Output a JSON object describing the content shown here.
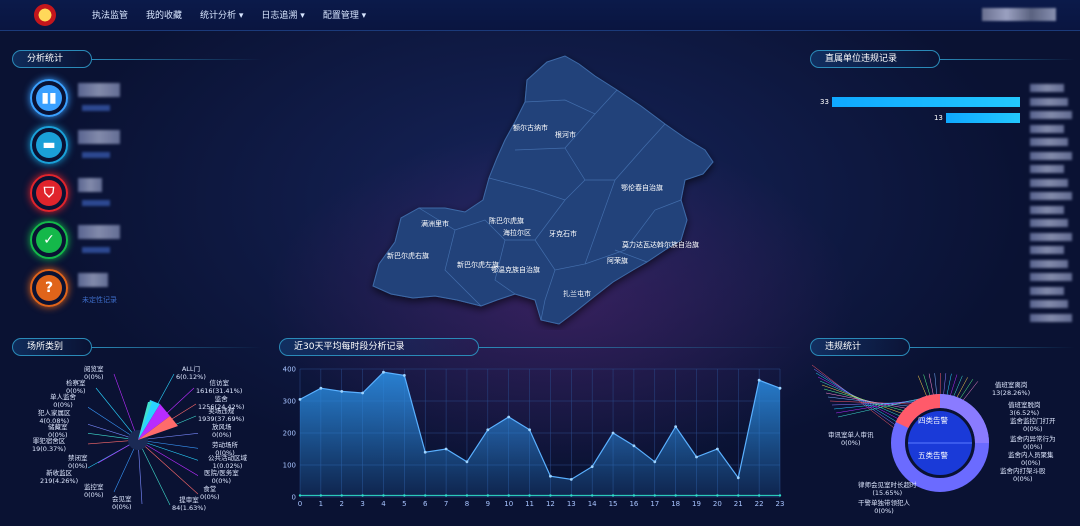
{
  "nav": {
    "items": [
      {
        "label": "执法监管"
      },
      {
        "label": "我的收藏"
      },
      {
        "label": "统计分析 ▾"
      },
      {
        "label": "日志追溯 ▾"
      },
      {
        "label": "配置管理 ▾"
      }
    ]
  },
  "analysis": {
    "title": "分析统计",
    "items": [
      {
        "icon": "bar-chart-icon",
        "color": "#3aa0ff",
        "label": ""
      },
      {
        "icon": "document-icon",
        "color": "#1aa0d8",
        "label": ""
      },
      {
        "icon": "shield-alert-icon",
        "color": "#e0242c",
        "label": ""
      },
      {
        "icon": "check-icon",
        "color": "#14b84a",
        "label": ""
      },
      {
        "icon": "question-icon",
        "color": "#e0641a",
        "label": "未定性记录"
      }
    ]
  },
  "map": {
    "regions": [
      {
        "name": "额尔古纳市"
      },
      {
        "name": "根河市"
      },
      {
        "name": "鄂伦春自治旗"
      },
      {
        "name": "满洲里市"
      },
      {
        "name": "陈巴尔虎旗"
      },
      {
        "name": "海拉尔区"
      },
      {
        "name": "牙克石市"
      },
      {
        "name": "莫力达瓦达斡尔族自治旗"
      },
      {
        "name": "新巴尔虎右旗"
      },
      {
        "name": "新巴尔虎左旗"
      },
      {
        "name": "鄂温克族自治旗"
      },
      {
        "name": "阿荣旗"
      },
      {
        "name": "扎兰屯市"
      }
    ]
  },
  "violations_by_unit": {
    "title": "直属单位违规记录",
    "bars": [
      33,
      13
    ]
  },
  "venue": {
    "title": "场所类别",
    "labels": [
      {
        "name": "ALL门",
        "value": "6(0.12%)"
      },
      {
        "name": "信访室",
        "value": "1616(31.41%)"
      },
      {
        "name": "监舍",
        "value": "1256(24.42%)"
      },
      {
        "name": "卖场违规",
        "value": "1939(37.69%)"
      },
      {
        "name": "放风场",
        "value": "0(0%)"
      },
      {
        "name": "劳动场所",
        "value": "0(0%)"
      },
      {
        "name": "公共活动区域",
        "value": "1(0.02%)"
      },
      {
        "name": "医院/医务室",
        "value": "0(0%)"
      },
      {
        "name": "食堂",
        "value": "0(0%)"
      },
      {
        "name": "提审室",
        "value": "84(1.63%)"
      },
      {
        "name": "会见室",
        "value": "0(0%)"
      },
      {
        "name": "监控室",
        "value": "0(0%)"
      },
      {
        "name": "新收监区",
        "value": "219(4.26%)"
      },
      {
        "name": "禁闭室",
        "value": "0(0%)"
      },
      {
        "name": "罪犯宿舍区",
        "value": "19(0.37%)"
      },
      {
        "name": "储藏室",
        "value": "0(0%)"
      },
      {
        "name": "犯人家属区",
        "value": "4(0.08%)"
      },
      {
        "name": "单人监舍",
        "value": "0(0%)"
      },
      {
        "name": "检察室",
        "value": "0(0%)"
      },
      {
        "name": "阅览室",
        "value": "0(0%)"
      }
    ]
  },
  "hourly": {
    "title": "近30天平均每时段分析记录"
  },
  "chart_data": {
    "type": "area",
    "x": [
      0,
      1,
      2,
      3,
      4,
      5,
      6,
      7,
      8,
      9,
      10,
      11,
      12,
      13,
      14,
      15,
      16,
      17,
      18,
      19,
      20,
      21,
      22,
      23
    ],
    "series": [
      {
        "values": [
          305,
          340,
          330,
          325,
          390,
          380,
          140,
          150,
          110,
          210,
          250,
          210,
          65,
          55,
          95,
          200,
          160,
          110,
          220,
          125,
          150,
          60,
          365,
          340
        ]
      },
      {
        "values": [
          5,
          5,
          5,
          5,
          5,
          5,
          5,
          5,
          5,
          5,
          5,
          5,
          5,
          5,
          5,
          5,
          5,
          5,
          5,
          5,
          5,
          5,
          5,
          5
        ]
      }
    ],
    "ylim": [
      0,
      400
    ],
    "yticks": [
      0,
      100,
      200,
      300,
      400
    ],
    "grid": true
  },
  "violation_stats": {
    "title": "违规统计",
    "center_top": "四类告警",
    "center_bottom": "五类告警",
    "labels": [
      {
        "name": "值班室离岗",
        "value": "13(28.26%)"
      },
      {
        "name": "值班室脱岗",
        "value": "3(6.52%)"
      },
      {
        "name": "监舍监控门打开",
        "value": "0(0%)"
      },
      {
        "name": "监舍内异常行为",
        "value": "0(0%)"
      },
      {
        "name": "监舍内人员聚集",
        "value": "0(0%)"
      },
      {
        "name": "监舍内打架斗殴",
        "value": "0(0%)"
      },
      {
        "name": "审讯室单人审讯",
        "value": "0(0%)"
      },
      {
        "name": "律师会见室时长超时",
        "value": "(15.65%)"
      },
      {
        "name": "干警单独带领犯人",
        "value": "0(0%)"
      }
    ]
  }
}
